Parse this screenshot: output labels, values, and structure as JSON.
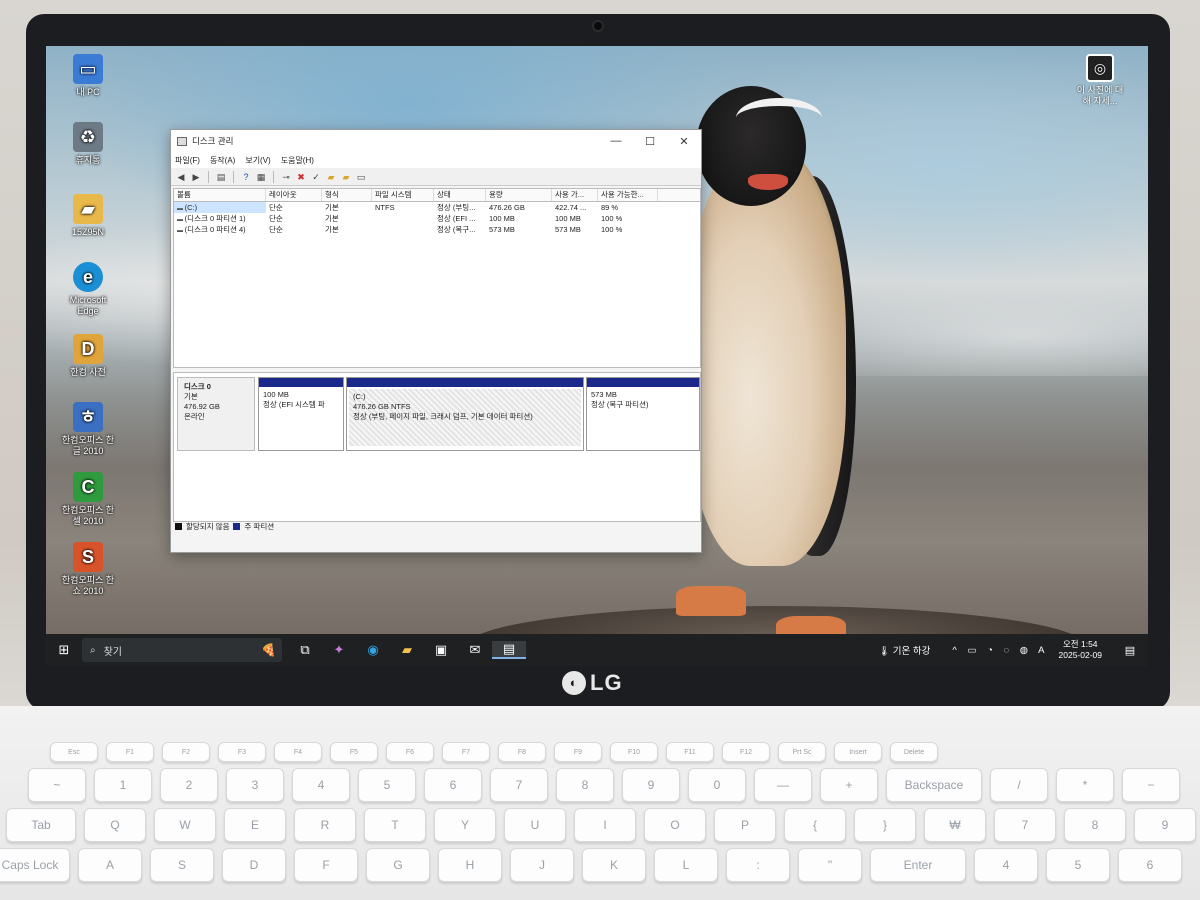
{
  "desktop_icons": [
    {
      "label": "내 PC",
      "icon": "pc-icon",
      "color": "#3a7bd5"
    },
    {
      "label": "휴지통",
      "icon": "recycle-bin-icon",
      "color": "#6c7a86"
    },
    {
      "label": "15Z95N",
      "icon": "user-folder-icon",
      "color": "#e8b84a"
    },
    {
      "label": "Microsoft Edge",
      "icon": "edge-icon",
      "color": "#1b8fd6"
    },
    {
      "label": "한컴 사전",
      "icon": "hancom-dictionary-icon",
      "color": "#e0a53a"
    },
    {
      "label": "한컴오피스 한글 2010",
      "icon": "hwp-icon",
      "color": "#3b6fc2"
    },
    {
      "label": "한컴오피스 한셀 2010",
      "icon": "hancell-icon",
      "color": "#2f9a3e"
    },
    {
      "label": "한컴오피스 한쇼 2010",
      "icon": "hanshow-icon",
      "color": "#d9532a"
    }
  ],
  "top_right_shortcut": {
    "label": "이 사진에 대해 자세...",
    "icon": "camera-info-icon"
  },
  "window": {
    "title": "디스크 관리",
    "controls": {
      "minimize": "—",
      "maximize": "☐",
      "close": "✕"
    },
    "menu": [
      "파일(F)",
      "동작(A)",
      "보기(V)",
      "도움말(H)"
    ],
    "columns": [
      "볼륨",
      "레이아웃",
      "형식",
      "파일 시스템",
      "상태",
      "용량",
      "사용 가...",
      "사용 가능한..."
    ],
    "volumes": [
      [
        "(C:)",
        "단순",
        "기본",
        "NTFS",
        "정상 (부팅...",
        "476.26 GB",
        "422.74 ...",
        "89 %"
      ],
      [
        "(디스크 0 파티션 1)",
        "단순",
        "기본",
        "",
        "정상 (EFI ...",
        "100 MB",
        "100 MB",
        "100 %"
      ],
      [
        "(디스크 0 파티션 4)",
        "단순",
        "기본",
        "",
        "정상 (복구...",
        "573 MB",
        "573 MB",
        "100 %"
      ]
    ],
    "disk": {
      "name": "디스크 0",
      "type": "기본",
      "size": "476.92 GB",
      "status": "온라인"
    },
    "partitions": [
      {
        "title": "",
        "size": "100 MB",
        "status": "정상 (EFI 시스템 파"
      },
      {
        "title": "(C:)",
        "size": "476.26 GB NTFS",
        "status": "정상 (부팅, 페이지 파일, 크래시 덤프, 기본 데이터 파티션)"
      },
      {
        "title": "",
        "size": "573 MB",
        "status": "정상 (복구 파티션)"
      }
    ],
    "legend": [
      {
        "label": "할당되지 않음",
        "color": "#111111"
      },
      {
        "label": "주 파티션",
        "color": "#1b2a8a"
      }
    ]
  },
  "taskbar": {
    "search_placeholder": "찾기",
    "weather": "🌡 기온 하강",
    "tray_icons": "^ ▭ ◔ ◌ ◍ A",
    "time": "오전 1:54",
    "date": "2025-02-09"
  },
  "brand": "LG",
  "keyboard": {
    "frow": [
      "Esc",
      "F1",
      "F2",
      "F3",
      "F4",
      "F5",
      "F6",
      "F7",
      "F8",
      "F9",
      "F10",
      "F11",
      "F12",
      "Prt Sc",
      "Insert",
      "Delete"
    ],
    "row1": [
      "~",
      "1",
      "2",
      "3",
      "4",
      "5",
      "6",
      "7",
      "8",
      "9",
      "0",
      "—",
      "+",
      "Backspace",
      "/",
      "*",
      "−"
    ],
    "row2": [
      "Tab",
      "Q",
      "W",
      "E",
      "R",
      "T",
      "Y",
      "U",
      "I",
      "O",
      "P",
      "{",
      "}",
      "₩",
      "7",
      "8",
      "9"
    ],
    "row3": [
      "Caps Lock",
      "A",
      "S",
      "D",
      "F",
      "G",
      "H",
      "J",
      "K",
      "L",
      ":",
      "\"",
      "Enter",
      "4",
      "5",
      "6"
    ]
  }
}
